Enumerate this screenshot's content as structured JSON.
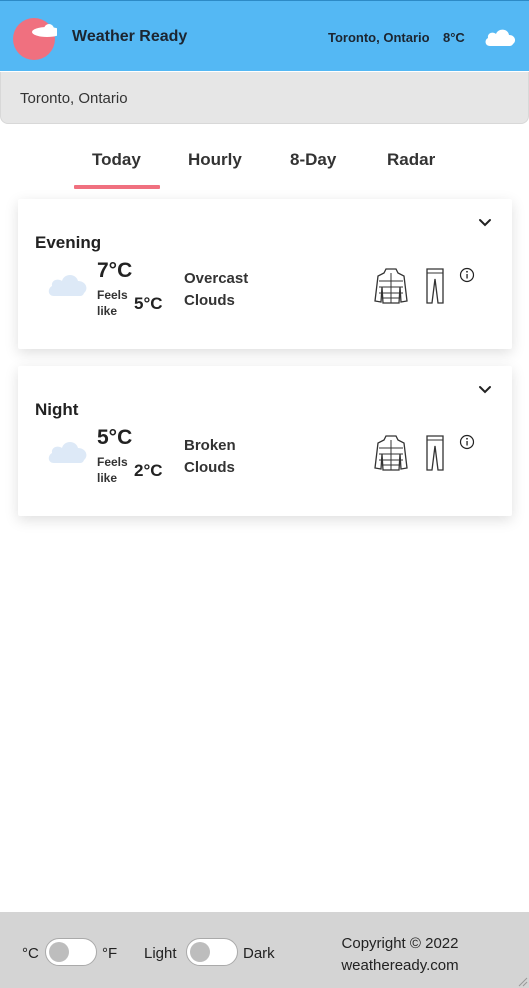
{
  "header": {
    "brand": "Weather Ready",
    "location": "Toronto, Ontario",
    "temperature": "8°C",
    "icon": "cloud-icon",
    "bg_color": "#54b8f4",
    "logo_color": "#f0707f"
  },
  "search": {
    "value": "Toronto, Ontario"
  },
  "tabs": [
    {
      "label": "Today",
      "active": true
    },
    {
      "label": "Hourly",
      "active": false
    },
    {
      "label": "8-Day",
      "active": false
    },
    {
      "label": "Radar",
      "active": false
    }
  ],
  "forecast": [
    {
      "period": "Evening",
      "temp": "7°C",
      "feels_label": "Feels like",
      "feels_temp": "5°C",
      "description": "Overcast Clouds",
      "weather_icon": "cloud-icon",
      "clothing_icons": [
        "jacket-icon",
        "pants-icon"
      ]
    },
    {
      "period": "Night",
      "temp": "5°C",
      "feels_label": "Feels like",
      "feels_temp": "2°C",
      "description": "Broken Clouds",
      "weather_icon": "cloud-icon",
      "clothing_icons": [
        "jacket-icon",
        "pants-icon"
      ]
    }
  ],
  "footer": {
    "unit_c": "°C",
    "unit_f": "°F",
    "mode_light": "Light",
    "mode_dark": "Dark",
    "copyright_line1": "Copyright © 2022",
    "copyright_line2": "weatheready.com"
  },
  "accent_color": "#f0707f"
}
